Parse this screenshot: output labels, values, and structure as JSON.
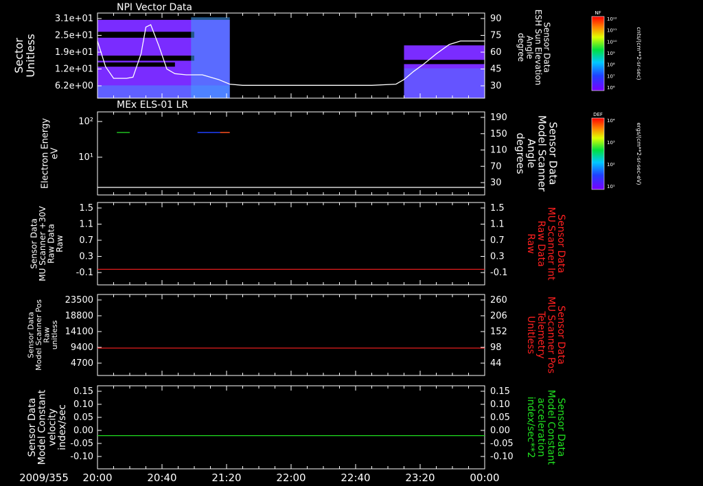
{
  "colors": {
    "background": "#000000",
    "frame": "#ffffff",
    "red_trace": "#ff2020",
    "green_trace": "#20e020",
    "spectro_base": "#7a2cff",
    "spectro_low": "#5a10e0",
    "spectro_cyan": "#40a0ff"
  },
  "footer": {
    "date": "2009/355",
    "time_ticks": [
      "20:00",
      "20:40",
      "21:20",
      "22:00",
      "22:40",
      "23:20",
      "00:00"
    ]
  },
  "colorbars": [
    {
      "name": "NF",
      "unit_label": "cnts/(cm**2-sr-sec)",
      "tick_labels": [
        "10¹²",
        "10¹¹",
        "10¹⁰",
        "10⁹",
        "10⁸",
        "10⁷",
        "10⁶"
      ]
    },
    {
      "name": "DEF",
      "unit_label": "ergs/(cm**2-sr-sec-eV)",
      "tick_labels": [
        "10⁴",
        "10³",
        "10²",
        "10¹"
      ]
    }
  ],
  "chart_data": [
    {
      "type": "heatmap",
      "title": "NPI Vector Data",
      "ylabel": [
        "Sector",
        "Unitless"
      ],
      "yticks": [
        "3.1e+01",
        "2.5e+01",
        "1.9e+01",
        "1.2e+01",
        "6.2e+00"
      ],
      "right_ylabel": [
        "Sensor Data",
        "ESH Sun Elevation",
        "Angle",
        "degree"
      ],
      "right_yticks": [
        "90",
        "75",
        "60",
        "45",
        "30"
      ],
      "right_ylim": [
        17,
        90
      ],
      "xlim_minutes": [
        0,
        240
      ],
      "data_intervals_minutes": [
        [
          0,
          82
        ],
        [
          190,
          240
        ]
      ],
      "overlay_series": {
        "name": "ESH Sun Elevation Angle",
        "t_minutes": [
          0,
          5,
          10,
          18,
          22,
          27,
          30,
          33,
          38,
          43,
          48,
          55,
          65,
          75,
          82,
          90,
          110,
          140,
          170,
          185,
          190,
          196,
          202,
          210,
          218,
          225,
          240
        ],
        "values": [
          66,
          44,
          34,
          34,
          35,
          55,
          78,
          80,
          62,
          42,
          38,
          37,
          37,
          33,
          29,
          28,
          28,
          28,
          28,
          29,
          33,
          40,
          46,
          55,
          63,
          66,
          66
        ]
      }
    },
    {
      "type": "heatmap",
      "title": "MEx ELS-01 LR",
      "ylabel": [
        "Electron Energy",
        "eV"
      ],
      "yticks": [
        "10²",
        "10¹"
      ],
      "right_ylabel": [
        "Sensor Data",
        "Model Scanner",
        "Angle",
        "degrees"
      ],
      "right_yticks": [
        "190",
        "150",
        "110",
        "70",
        "30"
      ],
      "right_ylim": [
        0,
        190
      ],
      "line_value": 10,
      "segments_minutes": [
        {
          "t": [
            12,
            20
          ],
          "color": "#20c020"
        },
        {
          "t": [
            62,
            76
          ],
          "color": "#2040ff"
        },
        {
          "t": [
            76,
            82
          ],
          "color": "#ff5020"
        }
      ]
    },
    {
      "type": "line",
      "ylabel": [
        "Sensor Data",
        "MU Scanner +30V",
        "Raw Data",
        "Raw"
      ],
      "yticks": [
        "1.5",
        "1.1",
        "0.7",
        "0.3",
        "-0.1"
      ],
      "ylim": [
        -0.35,
        1.5
      ],
      "right_ylabel": [
        "Sensor Data",
        "MU Scanner Int",
        "Raw Data",
        "Raw"
      ],
      "right_yticks": [
        "1.5",
        "1.1",
        "0.7",
        "0.3",
        "-0.1"
      ],
      "series": [
        {
          "t_minutes": [
            0,
            240
          ],
          "values": [
            0.0,
            0.0
          ],
          "color": "#ff2020"
        }
      ]
    },
    {
      "type": "line",
      "ylabel": [
        "Sensor Data",
        "Model Scanner Pos",
        "Raw",
        "unitless"
      ],
      "yticks": [
        "23500",
        "18800",
        "14100",
        "9400",
        "4700"
      ],
      "ylim": [
        0,
        23500
      ],
      "right_ylabel": [
        "Sensor Data",
        "MU Scanner Pos",
        "Telemetry",
        "Unitless"
      ],
      "right_yticks": [
        "260",
        "206",
        "152",
        "98",
        "44"
      ],
      "series": [
        {
          "t_minutes": [
            0,
            240
          ],
          "values": [
            7950,
            7950
          ],
          "color": "#ff2020"
        }
      ]
    },
    {
      "type": "line",
      "ylabel": [
        "Sensor Data",
        "Model Constant",
        "velocity",
        "index/sec"
      ],
      "yticks": [
        "0.15",
        "0.10",
        "0.05",
        "0.00",
        "-0.05",
        "-0.10"
      ],
      "ylim": [
        -0.1,
        0.15
      ],
      "right_ylabel": [
        "Sensor Data",
        "Model Constant",
        "acceleration",
        "index/sec**2"
      ],
      "right_yticks": [
        "0.15",
        "0.10",
        "0.05",
        "0.00",
        "-0.05",
        "-0.10"
      ],
      "series": [
        {
          "t_minutes": [
            0,
            0
          ],
          "values": [
            0.0,
            0.0
          ],
          "color": "#20e020"
        }
      ]
    }
  ]
}
